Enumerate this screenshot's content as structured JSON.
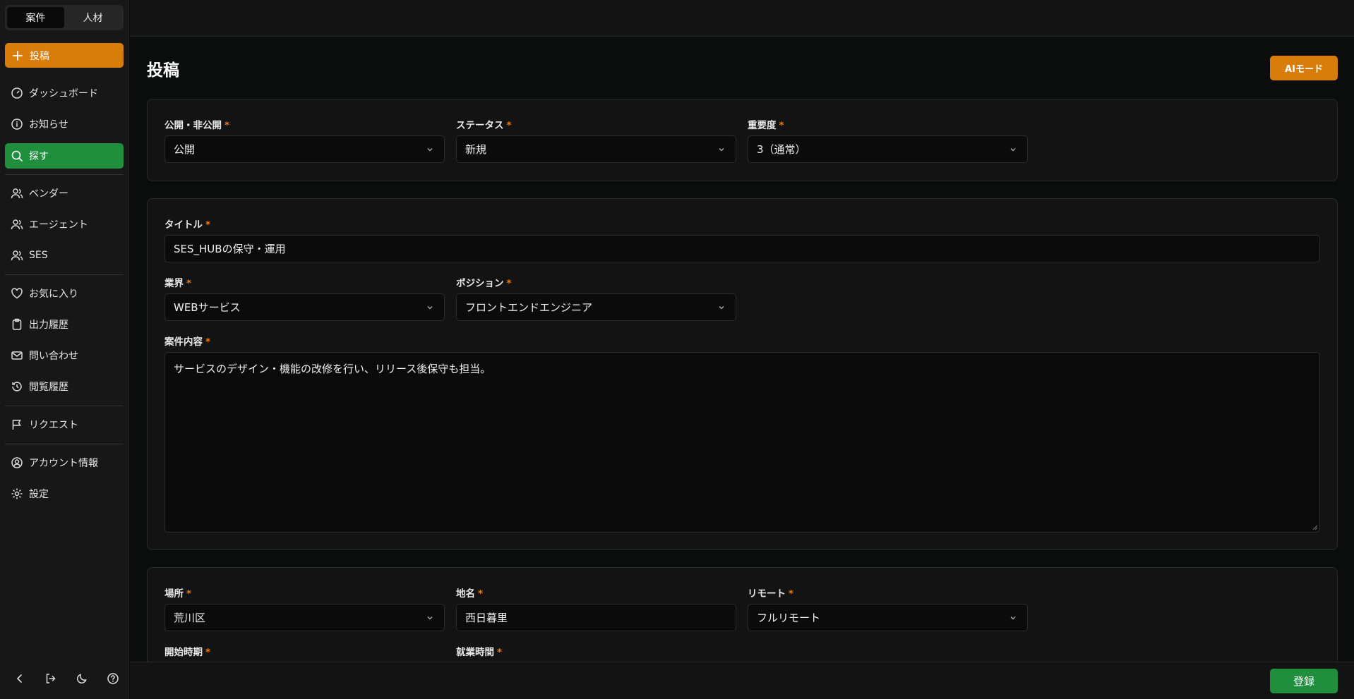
{
  "sidebar": {
    "segment": {
      "left": "案件",
      "right": "人材",
      "active": "left"
    },
    "post_label": "投稿",
    "items": [
      {
        "id": "dashboard",
        "label": "ダッシュボード",
        "icon": "gauge-icon"
      },
      {
        "id": "notice",
        "label": "お知らせ",
        "icon": "info-icon"
      },
      {
        "id": "search",
        "label": "探す",
        "icon": "search-icon",
        "active": true
      },
      {
        "id": "vendor",
        "label": "ベンダー",
        "icon": "users-icon"
      },
      {
        "id": "agent",
        "label": "エージェント",
        "icon": "users-icon"
      },
      {
        "id": "ses",
        "label": "SES",
        "icon": "users-icon"
      },
      {
        "id": "favorites",
        "label": "お気に入り",
        "icon": "heart-icon"
      },
      {
        "id": "output-history",
        "label": "出力履歴",
        "icon": "clipboard-icon"
      },
      {
        "id": "contact",
        "label": "問い合わせ",
        "icon": "mail-icon"
      },
      {
        "id": "view-history",
        "label": "閲覧履歴",
        "icon": "history-icon"
      },
      {
        "id": "request",
        "label": "リクエスト",
        "icon": "flag-icon"
      },
      {
        "id": "account",
        "label": "アカウント情報",
        "icon": "user-circle-icon"
      },
      {
        "id": "settings",
        "label": "設定",
        "icon": "gear-icon"
      }
    ],
    "bottom_icons": [
      "chevron-left-icon",
      "logout-icon",
      "moon-icon",
      "help-icon"
    ]
  },
  "header": {
    "title": "投稿",
    "ai_mode_label": "AIモード"
  },
  "form": {
    "visibility": {
      "label": "公開・非公開",
      "value": "公開"
    },
    "status": {
      "label": "ステータス",
      "value": "新規"
    },
    "priority": {
      "label": "重要度",
      "value": "3（通常）"
    },
    "title": {
      "label": "タイトル",
      "value": "SES_HUBの保守・運用"
    },
    "industry": {
      "label": "業界",
      "value": "WEBサービス"
    },
    "position": {
      "label": "ポジション",
      "value": "フロントエンドエンジニア"
    },
    "description": {
      "label": "案件内容",
      "value": "サービスのデザイン・機能の改修を行い、リリース後保守も担当。"
    },
    "location": {
      "label": "場所",
      "value": "荒川区"
    },
    "place_name": {
      "label": "地名",
      "value": "西日暮里"
    },
    "remote": {
      "label": "リモート",
      "value": "フルリモート"
    },
    "start_date": {
      "label": "開始時期"
    },
    "work_hours": {
      "label": "就業時間"
    },
    "required_mark": "*"
  },
  "footer": {
    "submit_label": "登録"
  },
  "colors": {
    "accent_orange": "#d97d0a",
    "accent_green": "#1f8f3e"
  }
}
